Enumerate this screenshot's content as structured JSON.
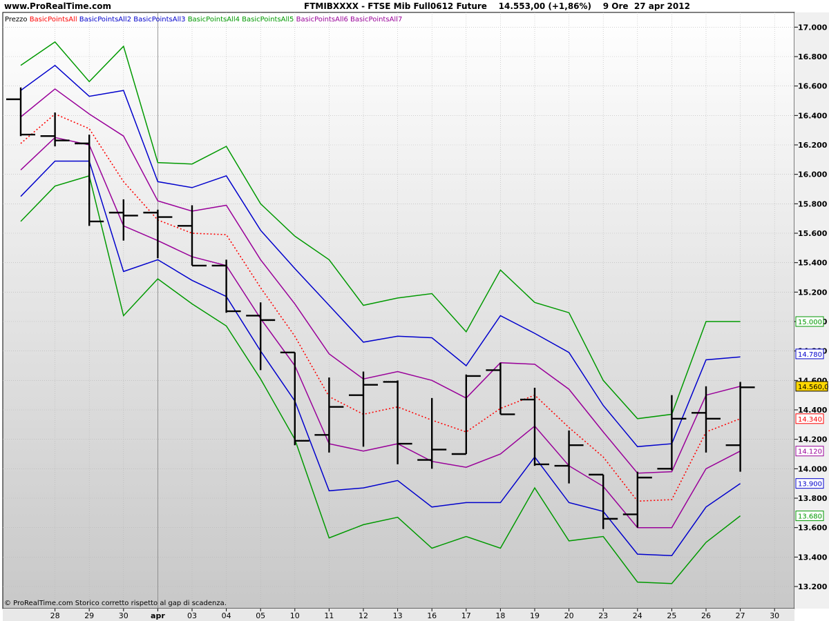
{
  "header": {
    "site": "www.ProRealTime.com",
    "title": "FTMIBXXXX - FTSE Mib Full0612 Future    14.553,00 (+1,86%)    9 Ore  27 apr 2012"
  },
  "footer": {
    "note": "© ProRealTime.com  Storico corretto rispetto al gap di scadenza."
  },
  "colors": {
    "red": "#ff0000",
    "blue": "#0000cc",
    "green": "#009900",
    "purple": "#990099",
    "price": "#000000",
    "current_badge": "#ffd700"
  },
  "chart_data": {
    "type": "line",
    "x": [
      "27",
      "28",
      "29",
      "30",
      "apr",
      "03",
      "04",
      "05",
      "10",
      "11",
      "12",
      "13",
      "16",
      "17",
      "18",
      "19",
      "20",
      "23",
      "24",
      "25",
      "26",
      "27"
    ],
    "x_axis_ticks": [
      "28",
      "29",
      "30",
      "apr",
      "03",
      "04",
      "05",
      "10",
      "11",
      "12",
      "13",
      "16",
      "17",
      "18",
      "19",
      "20",
      "23",
      "24",
      "25",
      "26",
      "27",
      "30"
    ],
    "ylim": [
      13050,
      17100
    ],
    "y_ticks": [
      13200,
      13400,
      13600,
      13800,
      14000,
      14200,
      14400,
      14600,
      14800,
      15000,
      15200,
      15400,
      15600,
      15800,
      16000,
      16200,
      16400,
      16600,
      16800,
      17000
    ],
    "y_tick_labels": [
      "13.200",
      "13.400",
      "13.600",
      "13.800",
      "14.000",
      "14.200",
      "14.400",
      "14.600",
      "14.800",
      "15.000",
      "15.200",
      "15.400",
      "15.600",
      "15.800",
      "16.000",
      "16.200",
      "16.400",
      "16.600",
      "16.800",
      "17.000"
    ],
    "legend": [
      {
        "label": "Prezzo",
        "color": "#000000"
      },
      {
        "label": "BasicPointsAll",
        "color": "#ff0000"
      },
      {
        "label": "BasicPointsAll2",
        "color": "#0000cc"
      },
      {
        "label": "BasicPointsAll3",
        "color": "#0000cc"
      },
      {
        "label": "BasicPointsAll4",
        "color": "#009900"
      },
      {
        "label": "BasicPointsAll5",
        "color": "#009900"
      },
      {
        "label": "BasicPointsAll6",
        "color": "#990099"
      },
      {
        "label": "BasicPointsAll7",
        "color": "#990099"
      }
    ],
    "series": [
      {
        "name": "BasicPointsAll",
        "color": "#ff0000",
        "dashed": true,
        "values": [
          16210,
          16410,
          16310,
          15950,
          15690,
          15600,
          15590,
          15230,
          14900,
          14490,
          14370,
          14420,
          14330,
          14250,
          14410,
          14500,
          14280,
          14080,
          13780,
          13790,
          14250,
          14340
        ]
      },
      {
        "name": "BasicPointsAll2",
        "color": "#0000cc",
        "dashed": false,
        "values": [
          16570,
          16740,
          16530,
          16570,
          15950,
          15910,
          15990,
          15620,
          15360,
          15110,
          14860,
          14900,
          14890,
          14700,
          15040,
          14920,
          14790,
          14430,
          14150,
          14170,
          14740,
          14760
        ]
      },
      {
        "name": "BasicPointsAll3",
        "color": "#0000cc",
        "dashed": false,
        "values": [
          15850,
          16090,
          16090,
          15340,
          15420,
          15280,
          15170,
          14800,
          14460,
          13850,
          13870,
          13920,
          13740,
          13770,
          13770,
          14080,
          13770,
          13710,
          13420,
          13410,
          13740,
          13900
        ]
      },
      {
        "name": "BasicPointsAll4",
        "color": "#009900",
        "dashed": false,
        "values": [
          16740,
          16900,
          16630,
          16870,
          16080,
          16070,
          16190,
          15800,
          15580,
          15420,
          15110,
          15160,
          15190,
          14930,
          15350,
          15130,
          15060,
          14600,
          14340,
          14370,
          15000,
          15000
        ]
      },
      {
        "name": "BasicPointsAll5",
        "color": "#009900",
        "dashed": false,
        "values": [
          15680,
          15920,
          15990,
          15040,
          15290,
          15120,
          14970,
          14610,
          14200,
          13530,
          13620,
          13670,
          13460,
          13540,
          13460,
          13870,
          13510,
          13540,
          13230,
          13220,
          13500,
          13680
        ]
      },
      {
        "name": "BasicPointsAll6",
        "color": "#990099",
        "dashed": false,
        "values": [
          16390,
          16580,
          16410,
          16260,
          15820,
          15750,
          15790,
          15420,
          15120,
          14780,
          14610,
          14660,
          14600,
          14480,
          14720,
          14710,
          14540,
          14250,
          13970,
          13980,
          14500,
          14560
        ]
      },
      {
        "name": "BasicPointsAll7",
        "color": "#990099",
        "dashed": false,
        "values": [
          16030,
          16250,
          16200,
          15650,
          15550,
          15440,
          15380,
          15020,
          14700,
          14170,
          14120,
          14170,
          14050,
          14010,
          14100,
          14290,
          14020,
          13880,
          13600,
          13600,
          14000,
          14120
        ]
      }
    ],
    "price_bars": [
      {
        "high": 16590,
        "low": 16260,
        "open": 16510,
        "close": 16270
      },
      {
        "high": 16420,
        "low": 16190,
        "open": 16260,
        "close": 16230
      },
      {
        "high": 16270,
        "low": 15650,
        "open": 16210,
        "close": 15680
      },
      {
        "high": 15830,
        "low": 15550,
        "open": 15740,
        "close": 15720
      },
      {
        "high": 15760,
        "low": 15430,
        "open": 15740,
        "close": 15710
      },
      {
        "high": 15790,
        "low": 15380,
        "open": 15650,
        "close": 15380
      },
      {
        "high": 15420,
        "low": 15060,
        "open": 15380,
        "close": 15070
      },
      {
        "high": 15130,
        "low": 14670,
        "open": 15040,
        "close": 15010
      },
      {
        "high": 14790,
        "low": 14160,
        "open": 14790,
        "close": 14190
      },
      {
        "high": 14620,
        "low": 14110,
        "open": 14230,
        "close": 14420
      },
      {
        "high": 14660,
        "low": 14150,
        "open": 14500,
        "close": 14570
      },
      {
        "high": 14600,
        "low": 14030,
        "open": 14590,
        "close": 14170
      },
      {
        "high": 14480,
        "low": 14000,
        "open": 14060,
        "close": 14130
      },
      {
        "high": 14640,
        "low": 14100,
        "open": 14100,
        "close": 14630
      },
      {
        "high": 14720,
        "low": 14370,
        "open": 14670,
        "close": 14370
      },
      {
        "high": 14550,
        "low": 14020,
        "open": 14470,
        "close": 14030
      },
      {
        "high": 14260,
        "low": 13900,
        "open": 14020,
        "close": 14160
      },
      {
        "high": 13960,
        "low": 13590,
        "open": 13960,
        "close": 13660
      },
      {
        "high": 13980,
        "low": 13600,
        "open": 13690,
        "close": 13940
      },
      {
        "high": 14500,
        "low": 13990,
        "open": 14000,
        "close": 14340
      },
      {
        "high": 14560,
        "low": 14110,
        "open": 14380,
        "close": 14340
      },
      {
        "high": 14590,
        "low": 13980,
        "open": 14160,
        "close": 14553
      }
    ],
    "value_badges": [
      {
        "text": "15.000",
        "value": 15000,
        "color": "#009900"
      },
      {
        "text": "14.780",
        "value": 14780,
        "color": "#0000cc"
      },
      {
        "text": "14.560,0",
        "value": 14560,
        "color": "#000000",
        "highlight": true
      },
      {
        "text": "14.340",
        "value": 14340,
        "color": "#ff0000"
      },
      {
        "text": "14.120",
        "value": 14120,
        "color": "#990099"
      },
      {
        "text": "13.900",
        "value": 13900,
        "color": "#0000cc"
      },
      {
        "text": "13.680",
        "value": 13680,
        "color": "#009900"
      }
    ],
    "grid": true,
    "legend_position": "top-left"
  }
}
